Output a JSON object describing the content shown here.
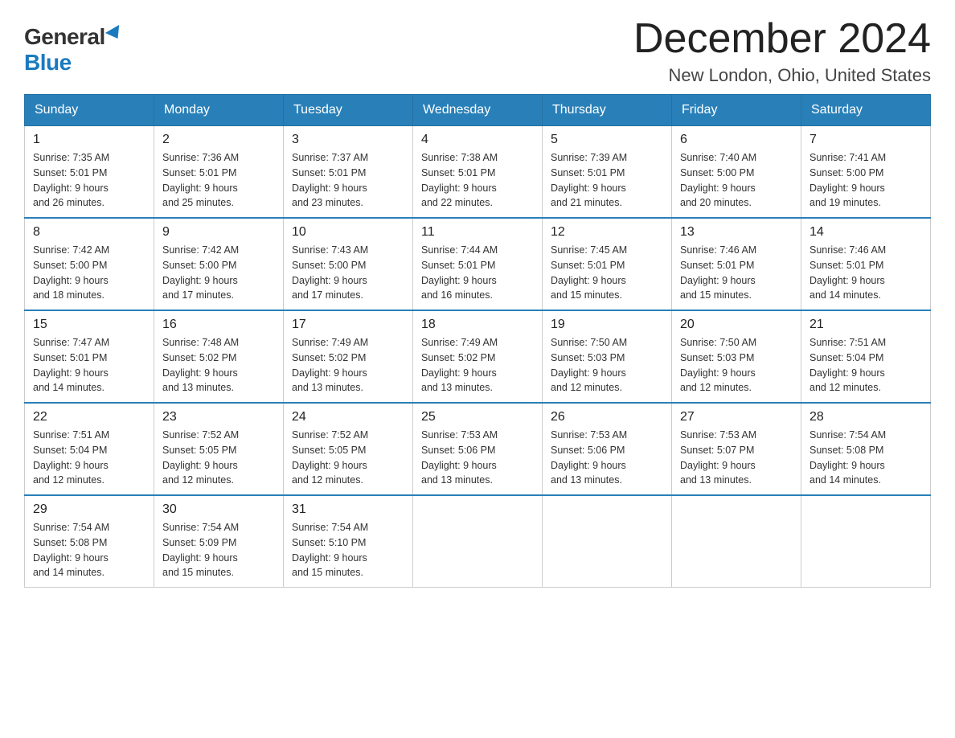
{
  "header": {
    "logo_general": "General",
    "logo_blue": "Blue",
    "month_title": "December 2024",
    "location": "New London, Ohio, United States"
  },
  "days_of_week": [
    "Sunday",
    "Monday",
    "Tuesday",
    "Wednesday",
    "Thursday",
    "Friday",
    "Saturday"
  ],
  "weeks": [
    [
      {
        "day": "1",
        "sunrise": "7:35 AM",
        "sunset": "5:01 PM",
        "daylight": "9 hours and 26 minutes."
      },
      {
        "day": "2",
        "sunrise": "7:36 AM",
        "sunset": "5:01 PM",
        "daylight": "9 hours and 25 minutes."
      },
      {
        "day": "3",
        "sunrise": "7:37 AM",
        "sunset": "5:01 PM",
        "daylight": "9 hours and 23 minutes."
      },
      {
        "day": "4",
        "sunrise": "7:38 AM",
        "sunset": "5:01 PM",
        "daylight": "9 hours and 22 minutes."
      },
      {
        "day": "5",
        "sunrise": "7:39 AM",
        "sunset": "5:01 PM",
        "daylight": "9 hours and 21 minutes."
      },
      {
        "day": "6",
        "sunrise": "7:40 AM",
        "sunset": "5:00 PM",
        "daylight": "9 hours and 20 minutes."
      },
      {
        "day": "7",
        "sunrise": "7:41 AM",
        "sunset": "5:00 PM",
        "daylight": "9 hours and 19 minutes."
      }
    ],
    [
      {
        "day": "8",
        "sunrise": "7:42 AM",
        "sunset": "5:00 PM",
        "daylight": "9 hours and 18 minutes."
      },
      {
        "day": "9",
        "sunrise": "7:42 AM",
        "sunset": "5:00 PM",
        "daylight": "9 hours and 17 minutes."
      },
      {
        "day": "10",
        "sunrise": "7:43 AM",
        "sunset": "5:00 PM",
        "daylight": "9 hours and 17 minutes."
      },
      {
        "day": "11",
        "sunrise": "7:44 AM",
        "sunset": "5:01 PM",
        "daylight": "9 hours and 16 minutes."
      },
      {
        "day": "12",
        "sunrise": "7:45 AM",
        "sunset": "5:01 PM",
        "daylight": "9 hours and 15 minutes."
      },
      {
        "day": "13",
        "sunrise": "7:46 AM",
        "sunset": "5:01 PM",
        "daylight": "9 hours and 15 minutes."
      },
      {
        "day": "14",
        "sunrise": "7:46 AM",
        "sunset": "5:01 PM",
        "daylight": "9 hours and 14 minutes."
      }
    ],
    [
      {
        "day": "15",
        "sunrise": "7:47 AM",
        "sunset": "5:01 PM",
        "daylight": "9 hours and 14 minutes."
      },
      {
        "day": "16",
        "sunrise": "7:48 AM",
        "sunset": "5:02 PM",
        "daylight": "9 hours and 13 minutes."
      },
      {
        "day": "17",
        "sunrise": "7:49 AM",
        "sunset": "5:02 PM",
        "daylight": "9 hours and 13 minutes."
      },
      {
        "day": "18",
        "sunrise": "7:49 AM",
        "sunset": "5:02 PM",
        "daylight": "9 hours and 13 minutes."
      },
      {
        "day": "19",
        "sunrise": "7:50 AM",
        "sunset": "5:03 PM",
        "daylight": "9 hours and 12 minutes."
      },
      {
        "day": "20",
        "sunrise": "7:50 AM",
        "sunset": "5:03 PM",
        "daylight": "9 hours and 12 minutes."
      },
      {
        "day": "21",
        "sunrise": "7:51 AM",
        "sunset": "5:04 PM",
        "daylight": "9 hours and 12 minutes."
      }
    ],
    [
      {
        "day": "22",
        "sunrise": "7:51 AM",
        "sunset": "5:04 PM",
        "daylight": "9 hours and 12 minutes."
      },
      {
        "day": "23",
        "sunrise": "7:52 AM",
        "sunset": "5:05 PM",
        "daylight": "9 hours and 12 minutes."
      },
      {
        "day": "24",
        "sunrise": "7:52 AM",
        "sunset": "5:05 PM",
        "daylight": "9 hours and 12 minutes."
      },
      {
        "day": "25",
        "sunrise": "7:53 AM",
        "sunset": "5:06 PM",
        "daylight": "9 hours and 13 minutes."
      },
      {
        "day": "26",
        "sunrise": "7:53 AM",
        "sunset": "5:06 PM",
        "daylight": "9 hours and 13 minutes."
      },
      {
        "day": "27",
        "sunrise": "7:53 AM",
        "sunset": "5:07 PM",
        "daylight": "9 hours and 13 minutes."
      },
      {
        "day": "28",
        "sunrise": "7:54 AM",
        "sunset": "5:08 PM",
        "daylight": "9 hours and 14 minutes."
      }
    ],
    [
      {
        "day": "29",
        "sunrise": "7:54 AM",
        "sunset": "5:08 PM",
        "daylight": "9 hours and 14 minutes."
      },
      {
        "day": "30",
        "sunrise": "7:54 AM",
        "sunset": "5:09 PM",
        "daylight": "9 hours and 15 minutes."
      },
      {
        "day": "31",
        "sunrise": "7:54 AM",
        "sunset": "5:10 PM",
        "daylight": "9 hours and 15 minutes."
      },
      null,
      null,
      null,
      null
    ]
  ],
  "labels": {
    "sunrise": "Sunrise:",
    "sunset": "Sunset:",
    "daylight": "Daylight:"
  }
}
